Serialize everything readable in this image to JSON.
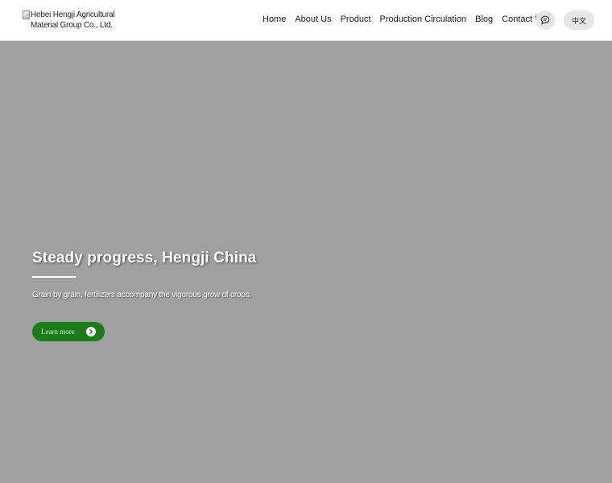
{
  "header": {
    "logo_alt": "Hebei Hengji Agricultural Material Group Co., Ltd.",
    "nav": [
      {
        "label": "Home"
      },
      {
        "label": "About Us"
      },
      {
        "label": "Product"
      },
      {
        "label": "Production Circulation"
      },
      {
        "label": "Blog"
      },
      {
        "label": "Contact Us"
      }
    ],
    "chat_icon": "chat-bubble-icon",
    "lang_label": "中文"
  },
  "hero": {
    "title": "Steady progress, Hengji China",
    "subtitle": "Grain by grain, fertilizers accompany the vigorous grow of crops.",
    "cta_label": "Learn more",
    "cta_icon": "chevron-right-circle-icon"
  },
  "colors": {
    "hero_bg": "#a0a0a0",
    "header_bg": "#ffffff",
    "cta_bg": "#1a7d1a"
  }
}
